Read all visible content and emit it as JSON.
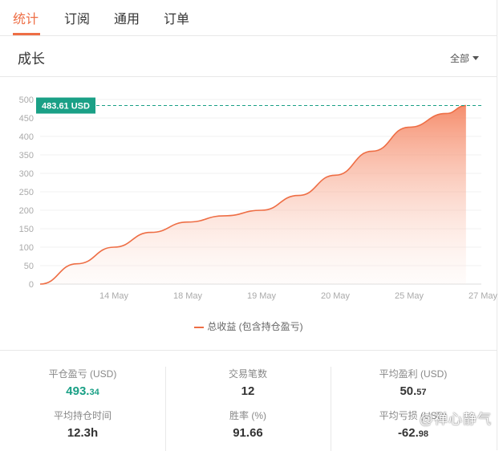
{
  "tabs": [
    {
      "label": "统计",
      "active": true
    },
    {
      "label": "订阅",
      "active": false
    },
    {
      "label": "通用",
      "active": false
    },
    {
      "label": "订单",
      "active": false
    }
  ],
  "section": {
    "title": "成长",
    "filter_label": "全部"
  },
  "chart_data": {
    "type": "area",
    "categories": [
      "14 May",
      "18 May",
      "19 May",
      "20 May",
      "25 May",
      "27 May"
    ],
    "yticks": [
      0,
      50,
      100,
      150,
      200,
      250,
      300,
      350,
      400,
      450,
      500
    ],
    "ylim": [
      0,
      500
    ],
    "series": [
      {
        "name": "总收益 (包含持仓盈亏)",
        "color": "#ee6e45",
        "points": [
          [
            0,
            0
          ],
          [
            0.5,
            55
          ],
          [
            1.0,
            100
          ],
          [
            1.5,
            140
          ],
          [
            2.0,
            168
          ],
          [
            2.5,
            185
          ],
          [
            3.0,
            200
          ],
          [
            3.5,
            240
          ],
          [
            4.0,
            295
          ],
          [
            4.5,
            360
          ],
          [
            5.0,
            425
          ],
          [
            5.5,
            462
          ],
          [
            5.77,
            483.61
          ]
        ]
      }
    ],
    "current_label": "483.61 USD",
    "current_value": 483.61,
    "legend": "总收益 (包含持仓盈亏)"
  },
  "stats": [
    {
      "label": "平仓盈亏 (USD)",
      "int": "493.",
      "frac": "34",
      "color": "green"
    },
    {
      "label": "交易笔数",
      "int": "12",
      "frac": ""
    },
    {
      "label": "平均盈利 (USD)",
      "int": "50.",
      "frac": "57"
    },
    {
      "label": "平均持仓时间",
      "int": "12.3h",
      "frac": ""
    },
    {
      "label": "胜率 (%)",
      "int": "91.66",
      "frac": ""
    },
    {
      "label": "平均亏损 (USD)",
      "int": "-62.",
      "frac": "98"
    }
  ],
  "watermark": "@禅心静气"
}
